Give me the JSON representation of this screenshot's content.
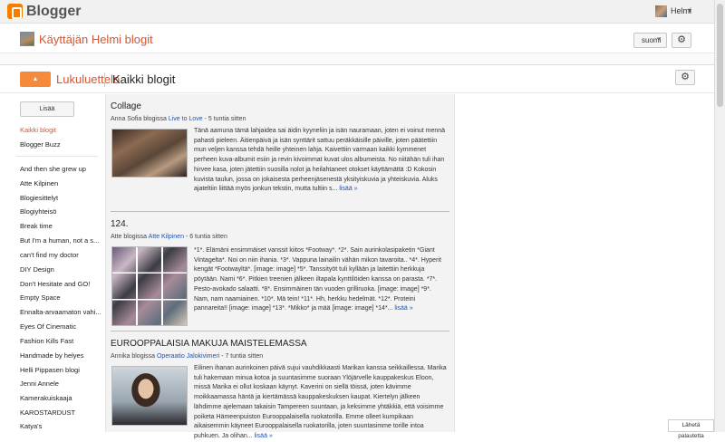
{
  "topbar": {
    "brand": "Blogger",
    "user_name": "Helmi",
    "caret": "▾"
  },
  "bloghead": {
    "title": "Käyttäjän Helmi blogit",
    "language": "suomi",
    "gear": "⚙"
  },
  "reading_list": {
    "button": "▲",
    "title": "Lukuluettelo",
    "subtitle": "Kaikki blogit",
    "gear": "⚙"
  },
  "sidebar": {
    "add_label": "Lisää",
    "pinned": [
      "Kaikki blogit",
      "Blogger Buzz"
    ],
    "blogs": [
      "And then she grew up",
      "Atte Kilpinen",
      "Blogiesittelyt",
      "Blogiyhteisö",
      "Break time",
      "But I'm a human, not a s...",
      "can't find my doctor",
      "DIY Design",
      "Don't Hesitate and GO!",
      "Empty Space",
      "Ennalta-arvaamaton vahi...",
      "Eyes Of Cinematic",
      "Fashion Kills Fast",
      "Handmade by helyes",
      "Helli Pippasen blogi",
      "Jenni Annele",
      "Kamerakuiskaaja",
      "KAROSTARDUST",
      "Katya's"
    ]
  },
  "posts": [
    {
      "title": "Collage",
      "author_prefix": "Anna Sofia blogissa",
      "blog": "Live to Love",
      "time": "- 5 tuntia sitten",
      "body": "Tänä aamuna tämä lahjaidea sai äidin kyyneliin ja isän nauramaan, joten ei voinut mennä pahasti pieleen. Äitienpäivä ja isän synttärit sattuu peräkkäisille päiville, joten päätettiin mun veljen kanssa tehdä heille yhteinen lahja. Kaivettiin varmaan kaikki kymmenet perheen kuva-albumit esiin ja revin kivoimmat kuvat ulos albumeista. No niitähän tuli ihan hirvee kasa, joten jätettiin suosilla nolot ja heilahtaneet otokset käyttämättä :D Kokosin kuvista taulun, jossa on jokaisesta perheenjäsenestä yksityiskuvia ja yhteiskuvia. Aluks ajateltiin liittää myös jonkun tekstin, mutta tultiin s...",
      "more": "lisää »"
    },
    {
      "title": "124.",
      "author_prefix": "Atte blogissa",
      "blog": "Atte Kilpinen",
      "time": "- 6 tuntia sitten",
      "body": "*1*. Elämäni ensimmäiset vanssit kiitos *Footway*. *2*. Sain aurinkolasipaketin *Giant Vintagelta*. Noi on niin ihania. *3*. Vappuna lainailin vähän mikon tavaroita.. *4*. Hyperit kengät *Footwayltä*. [image: image] *5*. Tanssityöt tuli kyllään ja laitettiin herkkuja pöytään. Nami *6*. Pitkien treenien jälkeen iltapala kynttilöiden kanssa on parasta. *7*. Pesto-avokado salaatti. *8*. Ensimmäinen tän vuoden grilliruoka. [image: image] *9*. Nam, nam naamiainen. *10*. Mä tein! *11*. Hh, herkku hedelmät. *12*. Proteini pannareita!! [image: image] *13*. *Mikko* ja mää [image: image] *14*...",
      "more": "lisää »"
    },
    {
      "title": "EUROOPPALAISIA MAKUJA MAISTELEMASSA",
      "author_prefix": "Annika blogissa",
      "blog": "Operaatio Jalokivimeri",
      "time": "- 7 tuntia sitten",
      "body": "Eilinen ihanan aurinkoinen päivä sujui vauhdikkaasti Marikan kanssa seikkaillessa. Marika tuli hakemaan minua kotoa ja suuntasimme suoraan Ylöjärvelle kauppakeskus Eloon, missä Marika ei ollut koskaan käynyt. Kaverini on siellä töissä, joten kävimme moikkaamassa häntä ja kiertämässä kauppakeskuksen kaupat. Kiertelyn jälkeen lähdimme ajelemaan takaisin Tampereen suuntaan, ja keksimme yhtäkkiä, että voisimme poiketa Hämeenpuiston Eurooppalaisella ruokatorilla. Emme olleet kumpikaan aikaisemmin käyneet Eurooppalaisella ruokatorilla, joten suuntasimme torille intoa puhkuen. Ja olihan...",
      "more": "lisää »"
    }
  ],
  "feedback": "Lähetä palautetta",
  "colors": {
    "accent": "#d9542f",
    "link": "#1a55b5",
    "brand": "#f57d00"
  }
}
